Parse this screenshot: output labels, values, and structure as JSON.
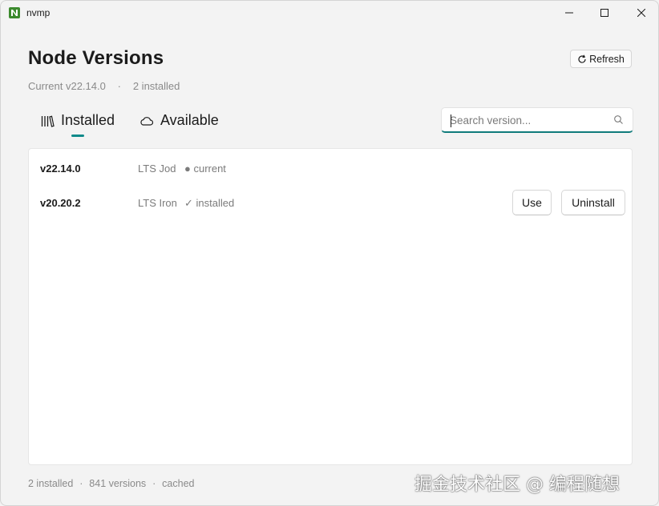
{
  "window": {
    "app_title": "nvmp",
    "minimize_label": "—",
    "maximize_label": "☐",
    "close_label": "✕"
  },
  "header": {
    "title": "Node Versions",
    "refresh_label": "Refresh",
    "current_label": "Current v22.14.0",
    "separator": "·",
    "installed_count_label": "2 installed"
  },
  "tabs": [
    {
      "label": "Installed",
      "icon": "library-icon",
      "active": true
    },
    {
      "label": "Available",
      "icon": "cloud-icon",
      "active": false
    }
  ],
  "search": {
    "placeholder": "Search version...",
    "value": ""
  },
  "versions": [
    {
      "version": "v22.14.0",
      "lts": "LTS Jod",
      "status": "● current",
      "actions": []
    },
    {
      "version": "v20.20.2",
      "lts": "LTS Iron",
      "status": "✓ installed",
      "actions": [
        "Use",
        "Uninstall"
      ]
    }
  ],
  "footer": {
    "installed": "2 installed",
    "versions": "841 versions",
    "cached": "cached",
    "separator": "·"
  },
  "watermark": "掘金技术社区 @ 编程随想",
  "colors": {
    "accent": "#0f8a8a",
    "logo": "#3c8a2e",
    "background": "#f3f3f3",
    "panel": "#ffffff"
  }
}
